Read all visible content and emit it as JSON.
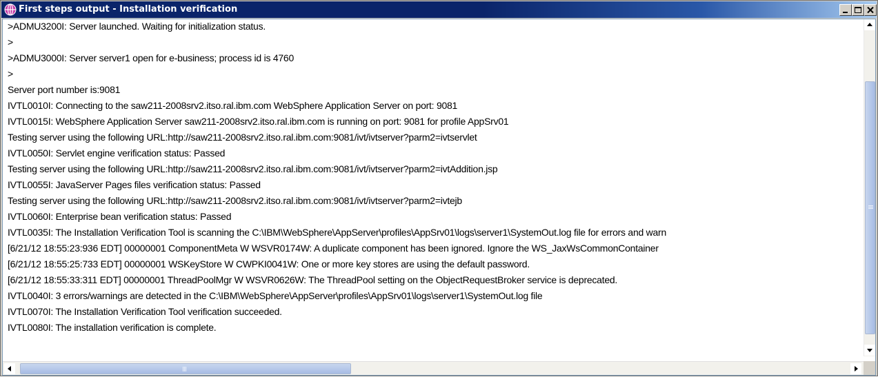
{
  "window": {
    "title": "First steps output  - Installation verification",
    "title_icon": "websphere-globe-icon",
    "controls": {
      "minimize": "minimize-icon",
      "maximize": "maximize-icon",
      "close": "close-icon"
    }
  },
  "colors": {
    "titlebar_start": "#0a246a",
    "titlebar_end": "#a6caf0",
    "scroll_thumb": "#b7c9ea",
    "log_background": "#ffffff"
  },
  "log": {
    "lines": [
      ">ADMU3200I: Server launched. Waiting for initialization status.",
      ">",
      ">ADMU3000I: Server server1 open for e-business; process id is 4760",
      ">",
      "Server port number is:9081",
      "IVTL0010I: Connecting to the saw211-2008srv2.itso.ral.ibm.com WebSphere Application Server on port: 9081",
      "IVTL0015I: WebSphere Application Server saw211-2008srv2.itso.ral.ibm.com is running on port: 9081 for profile AppSrv01",
      "Testing server using the following URL:http://saw211-2008srv2.itso.ral.ibm.com:9081/ivt/ivtserver?parm2=ivtservlet",
      "IVTL0050I: Servlet engine verification status: Passed",
      "Testing server using the following URL:http://saw211-2008srv2.itso.ral.ibm.com:9081/ivt/ivtserver?parm2=ivtAddition.jsp",
      "IVTL0055I: JavaServer Pages files verification status: Passed",
      "Testing server using the following URL:http://saw211-2008srv2.itso.ral.ibm.com:9081/ivt/ivtserver?parm2=ivtejb",
      "IVTL0060I: Enterprise bean verification status: Passed",
      "IVTL0035I: The Installation Verification Tool is scanning the C:\\IBM\\WebSphere\\AppServer\\profiles\\AppSrv01\\logs\\server1\\SystemOut.log file for errors and warn",
      "[6/21/12 18:55:23:936 EDT] 00000001 ComponentMeta W   WSVR0174W: A duplicate component has been ignored. Ignore the WS_JaxWsCommonContainer",
      "[6/21/12 18:55:25:733 EDT] 00000001 WSKeyStore    W   CWPKI0041W: One or more key stores are using the default password.",
      "[6/21/12 18:55:33:311 EDT] 00000001 ThreadPoolMgr W   WSVR0626W: The ThreadPool setting on the ObjectRequestBroker service is deprecated.",
      "IVTL0040I: 3 errors/warnings are detected in the C:\\IBM\\WebSphere\\AppServer\\profiles\\AppSrv01\\logs\\server1\\SystemOut.log file",
      "IVTL0070I: The Installation Verification Tool verification succeeded.",
      "IVTL0080I: The installation verification is complete."
    ]
  },
  "scrollbars": {
    "vertical_position": 0.3,
    "horizontal_position": 0.0
  }
}
